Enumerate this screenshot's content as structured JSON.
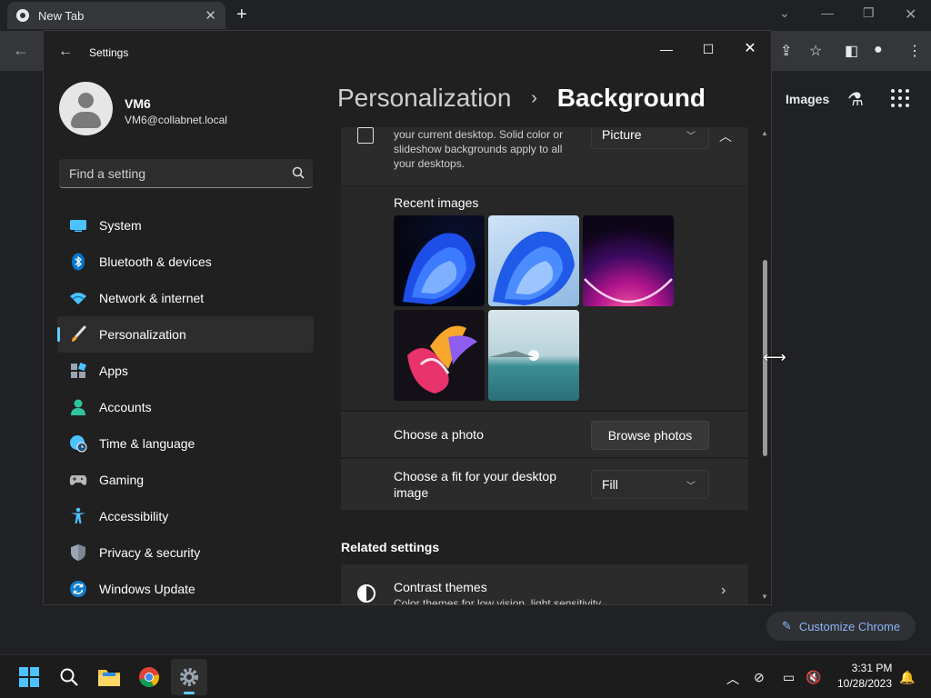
{
  "chrome": {
    "tab_title": "New Tab",
    "tab_close": "✕",
    "new_tab": "+",
    "images_link": "Images",
    "customize_label": "Customize Chrome"
  },
  "settings": {
    "window_title": "Settings",
    "user": {
      "name": "VM6",
      "email": "VM6@collabnet.local"
    },
    "search_placeholder": "Find a setting",
    "nav_items": [
      {
        "label": "System",
        "icon": "monitor-icon"
      },
      {
        "label": "Bluetooth & devices",
        "icon": "bluetooth-icon"
      },
      {
        "label": "Network & internet",
        "icon": "wifi-icon"
      },
      {
        "label": "Personalization",
        "icon": "brush-icon",
        "active": true
      },
      {
        "label": "Apps",
        "icon": "apps-icon"
      },
      {
        "label": "Accounts",
        "icon": "person-icon"
      },
      {
        "label": "Time & language",
        "icon": "globe-clock-icon"
      },
      {
        "label": "Gaming",
        "icon": "gamepad-icon"
      },
      {
        "label": "Accessibility",
        "icon": "accessibility-icon"
      },
      {
        "label": "Privacy & security",
        "icon": "shield-icon"
      },
      {
        "label": "Windows Update",
        "icon": "update-icon"
      }
    ],
    "breadcrumb": {
      "parent": "Personalization",
      "separator": "›",
      "current": "Background"
    },
    "background_desc": "your current desktop. Solid color or slideshow backgrounds apply to all your desktops.",
    "background_type": "Picture",
    "recent_images_label": "Recent images",
    "choose_photo_label": "Choose a photo",
    "browse_button": "Browse photos",
    "fit_label": "Choose a fit for your desktop image",
    "fit_value": "Fill",
    "related_title": "Related settings",
    "contrast": {
      "title": "Contrast themes",
      "subtitle": "Color themes for low vision, light sensitivity"
    }
  },
  "taskbar": {
    "time": "3:31 PM",
    "date": "10/28/2023"
  },
  "colors": {
    "accent": "#60cdff",
    "chrome_link": "#8ab4f8",
    "window_bg": "#202020",
    "card_bg": "#2b2b2b"
  }
}
